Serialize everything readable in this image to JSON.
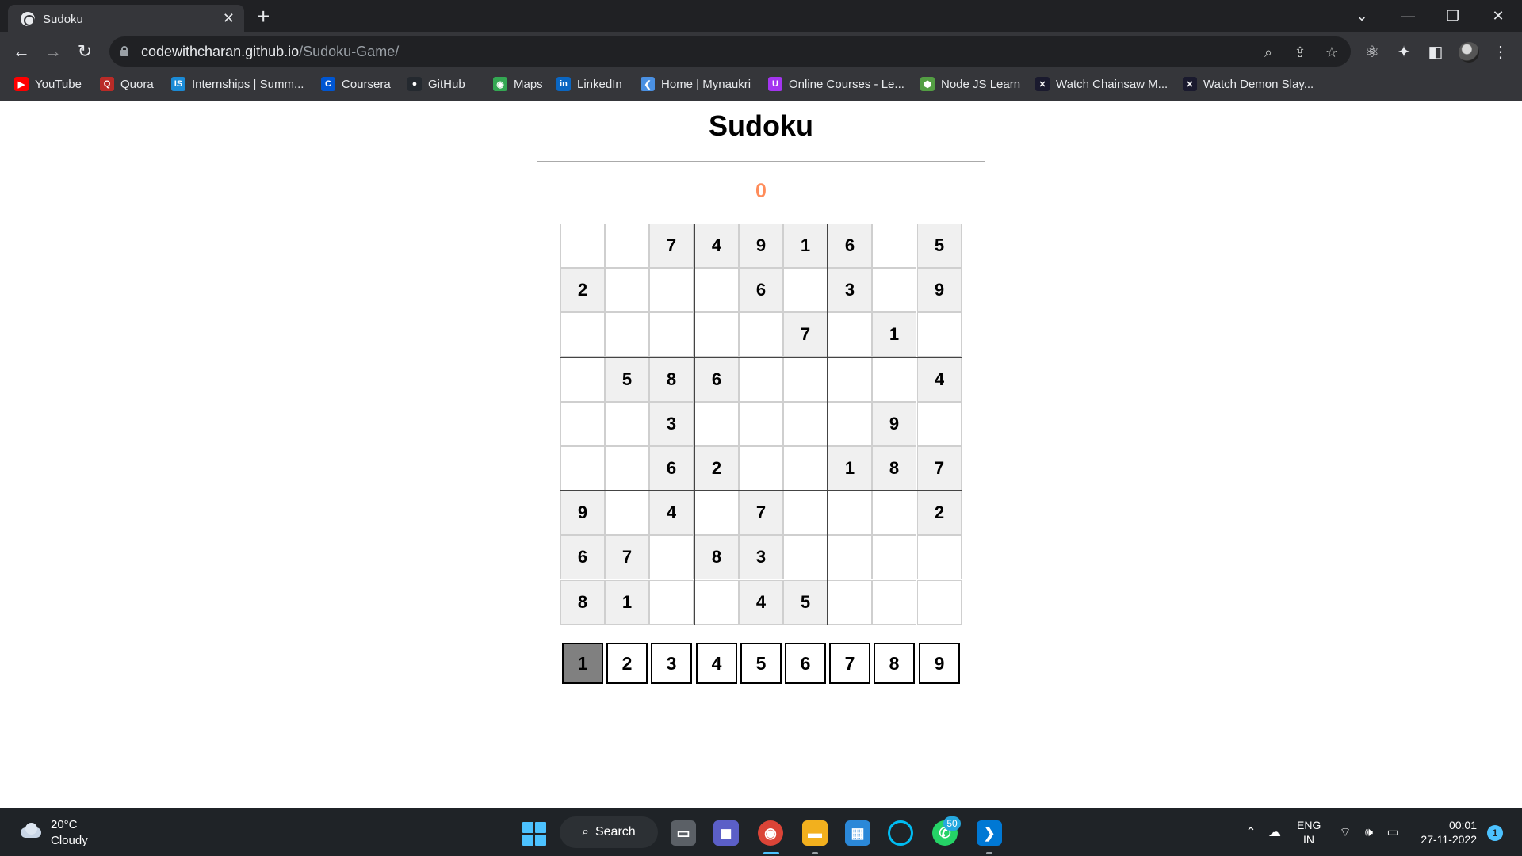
{
  "browser": {
    "tab_title": "Sudoku",
    "tab_close": "✕",
    "new_tab": "+",
    "url_host": "codewithcharan.github.io",
    "url_path": "/Sudoku-Game/",
    "window_controls": {
      "tab_search": "⌄",
      "minimize": "—",
      "restore": "❐",
      "close": "✕"
    },
    "bookmarks": [
      {
        "label": "YouTube",
        "icon": "youtube-icon",
        "color": "#ff0000",
        "glyph": "▶"
      },
      {
        "label": "Quora",
        "icon": "quora-icon",
        "color": "#b92b27",
        "glyph": "Q"
      },
      {
        "label": "Internships | Summ...",
        "icon": "internshala-icon",
        "color": "#1b8bd6",
        "glyph": "IS"
      },
      {
        "label": "Coursera",
        "icon": "coursera-icon",
        "color": "#0056d2",
        "glyph": "C"
      },
      {
        "label": "GitHub",
        "icon": "github-icon",
        "color": "#24292f",
        "glyph": "●"
      },
      {
        "label": "Maps",
        "icon": "maps-icon",
        "color": "#34a853",
        "glyph": "◉"
      },
      {
        "label": "LinkedIn",
        "icon": "linkedin-icon",
        "color": "#0a66c2",
        "glyph": "in"
      },
      {
        "label": "Home | Mynaukri",
        "icon": "naukri-icon",
        "color": "#4a90e2",
        "glyph": "❮"
      },
      {
        "label": "Online Courses - Le...",
        "icon": "udemy-icon",
        "color": "#a435f0",
        "glyph": "U"
      },
      {
        "label": "Node JS Learn",
        "icon": "nodejs-icon",
        "color": "#539e43",
        "glyph": "⬢"
      },
      {
        "label": "Watch Chainsaw M...",
        "icon": "anime-site-icon",
        "color": "#1a1a2e",
        "glyph": "✕"
      },
      {
        "label": "Watch Demon Slay...",
        "icon": "anime-site-icon",
        "color": "#1a1a2e",
        "glyph": "✕"
      }
    ]
  },
  "game": {
    "title": "Sudoku",
    "score": "0",
    "board": [
      [
        "",
        "",
        "7",
        "4",
        "9",
        "1",
        "6",
        "",
        "5"
      ],
      [
        "2",
        "",
        "",
        "",
        "6",
        "",
        "3",
        "",
        "9"
      ],
      [
        "",
        "",
        "",
        "",
        "",
        "7",
        "",
        "1",
        ""
      ],
      [
        "",
        "5",
        "8",
        "6",
        "",
        "",
        "",
        "",
        "4"
      ],
      [
        "",
        "",
        "3",
        "",
        "",
        "",
        "",
        "9",
        ""
      ],
      [
        "",
        "",
        "6",
        "2",
        "",
        "",
        "1",
        "8",
        "7"
      ],
      [
        "9",
        "",
        "4",
        "",
        "7",
        "",
        "",
        "",
        "2"
      ],
      [
        "6",
        "7",
        "",
        "8",
        "3",
        "",
        "",
        "",
        ""
      ],
      [
        "8",
        "1",
        "",
        "",
        "4",
        "5",
        "",
        "",
        ""
      ]
    ],
    "digits": [
      "1",
      "2",
      "3",
      "4",
      "5",
      "6",
      "7",
      "8",
      "9"
    ],
    "selected_digit": "1",
    "colors": {
      "score": "#ff8c5a",
      "given_cell": "#f0f0f0",
      "selected_digit": "#808080"
    }
  },
  "taskbar": {
    "weather_temp": "20°C",
    "weather_desc": "Cloudy",
    "search_label": "Search",
    "whatsapp_badge": "50",
    "language": "ENG",
    "region": "IN",
    "time": "00:01",
    "date": "27-11-2022",
    "notification_count": "1"
  }
}
